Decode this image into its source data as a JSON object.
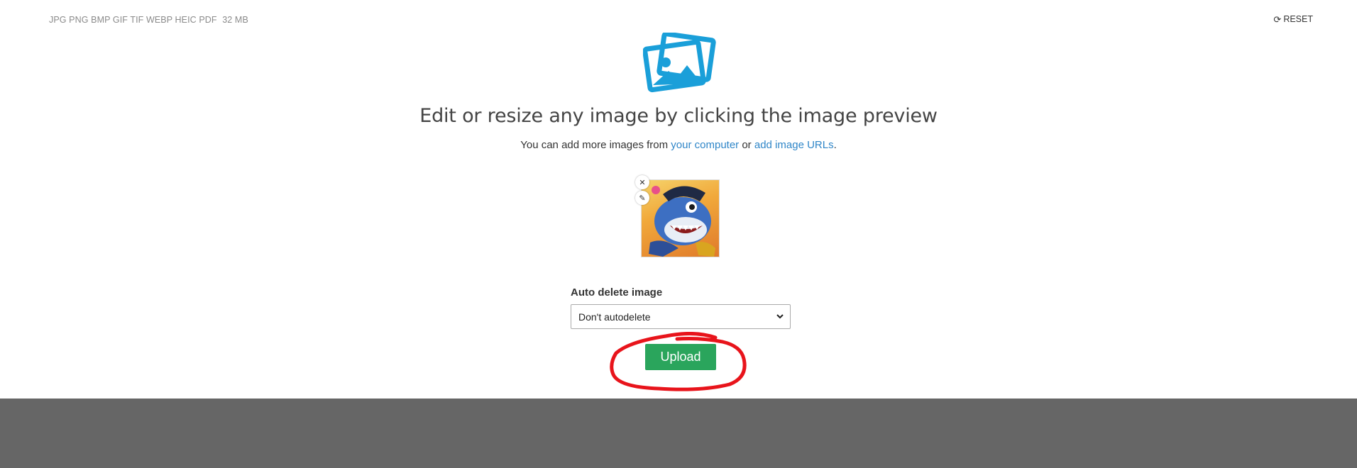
{
  "header": {
    "formats": "JPG PNG BMP GIF TIF WEBP HEIC PDF",
    "max_size": "32 MB",
    "reset_label": "RESET"
  },
  "main": {
    "headline": "Edit or resize any image by clicking the image preview",
    "subline_prefix": "You can add more images from",
    "computer_link": "your computer",
    "subline_or": "or",
    "urls_link": "add image URLs",
    "subline_end": "."
  },
  "thumbnail": {
    "close_glyph": "✕",
    "edit_glyph": "✎"
  },
  "auto_delete": {
    "label": "Auto delete image",
    "selected": "Don't autodelete"
  },
  "upload": {
    "label": "Upload"
  },
  "icons": {
    "logo": "images-stack-icon",
    "reset": "refresh-icon",
    "close": "close-icon",
    "edit": "pencil-icon",
    "dropdown": "chevron-down-icon"
  },
  "colors": {
    "logo": "#1a9fd9",
    "link": "#2f86c8",
    "upload_button": "#2aa55c",
    "annotation": "#e8141b",
    "footer": "#666666"
  }
}
